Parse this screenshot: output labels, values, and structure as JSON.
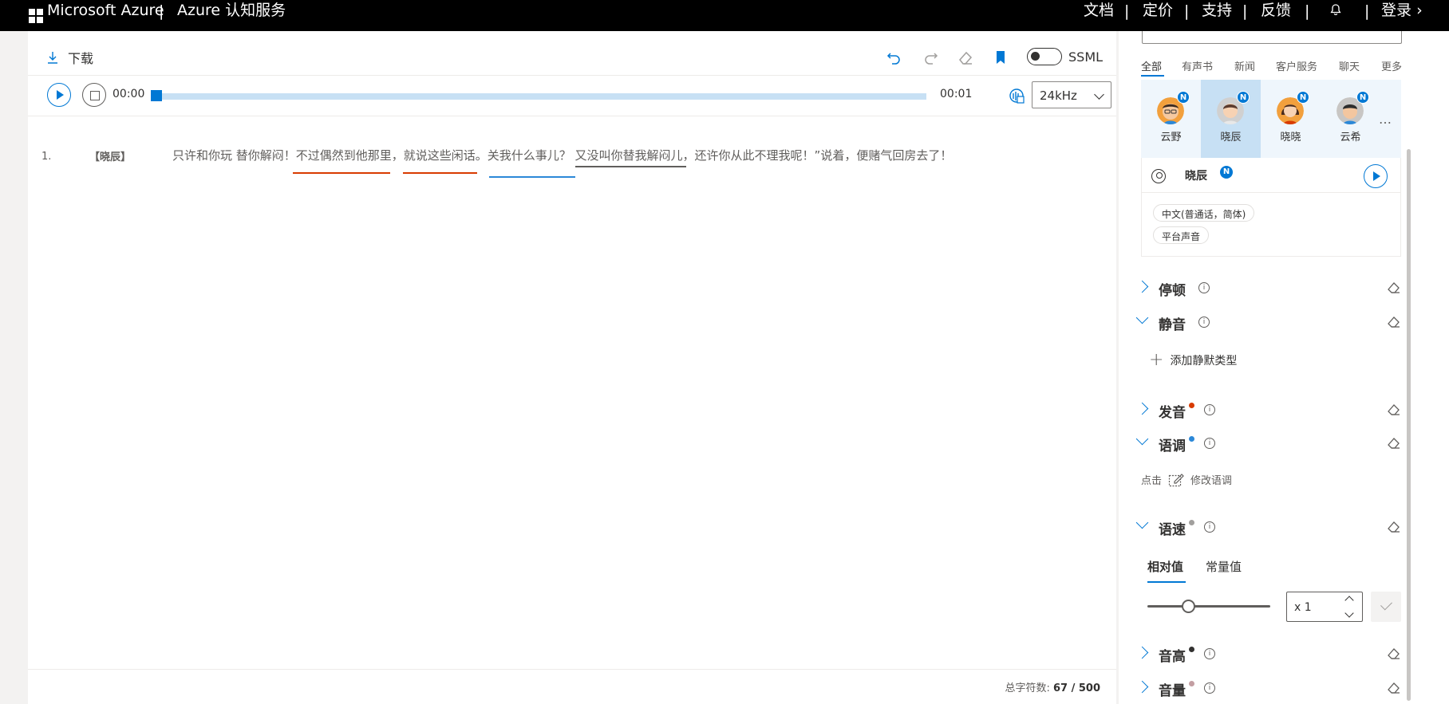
{
  "topnav": {
    "brand": "Microsoft Azure",
    "separator": "|",
    "product": "Azure 认知服务",
    "links": [
      "文档",
      "定价",
      "支持",
      "反馈"
    ],
    "signin": "登录",
    "signin_chevron": "›"
  },
  "toolbar": {
    "download_label": "下载",
    "ssml_label": "SSML",
    "ssml_enabled": false
  },
  "player": {
    "time_current": "00:00",
    "time_total": "00:01",
    "progress": 0,
    "sample_rate": "24kHz"
  },
  "editor": {
    "line_number": "1.",
    "speaker": "【晓辰】",
    "sentence": "只许和你玩 替你解闷！不过偶然到他那里，就说这些闲话。关我什么事儿？ 又没叫你替我解闷儿，还许你从此不理我呢！”说着，便赌气回房去了！",
    "highlight_colors": {
      "pronunciation": "#d83b01",
      "tone": "#2b88d8",
      "neutral": "#605e5c"
    }
  },
  "footer": {
    "count_label": "总字符数:",
    "count_value": "67 / 500"
  },
  "voice_panel": {
    "categories": [
      "全部",
      "有声书",
      "新闻",
      "客户服务",
      "聊天",
      "更多"
    ],
    "active_category": "全部",
    "voices": [
      {
        "name": "云野",
        "badge": "N",
        "icon": "avatar-man-glasses"
      },
      {
        "name": "晓辰",
        "badge": "N",
        "icon": "avatar-woman",
        "selected": true
      },
      {
        "name": "晓晓",
        "badge": "N",
        "icon": "avatar-woman-brown-hair"
      },
      {
        "name": "云希",
        "badge": "N",
        "icon": "avatar-man"
      }
    ],
    "more_label": "…",
    "current": {
      "name": "晓辰",
      "badge": "N",
      "tags": [
        "中文(普通话，简体)",
        "平台声音"
      ]
    }
  },
  "sections": {
    "pause": {
      "title": "停顿",
      "expanded": false
    },
    "silence": {
      "title": "静音",
      "expanded": true,
      "add_label": "添加静默类型"
    },
    "pronunciation": {
      "title": "发音",
      "expanded": false,
      "dot_color": "#d83b01"
    },
    "tone": {
      "title": "语调",
      "expanded": true,
      "dot_color": "#2b88d8",
      "hint_prefix": "点击",
      "hint_action": "修改语调"
    },
    "rate": {
      "title": "语速",
      "expanded": true,
      "dot_color": "#a19f9d",
      "tabs": [
        "相对值",
        "常量值"
      ],
      "active_tab": "相对值",
      "value": "x 1",
      "slider_fraction": 0.33
    },
    "pitch": {
      "title": "音高",
      "expanded": false,
      "dot_color": "#323130"
    },
    "volume": {
      "title": "音量",
      "expanded": false,
      "dot_color": "#c39ea2"
    }
  },
  "info_glyph": "i"
}
